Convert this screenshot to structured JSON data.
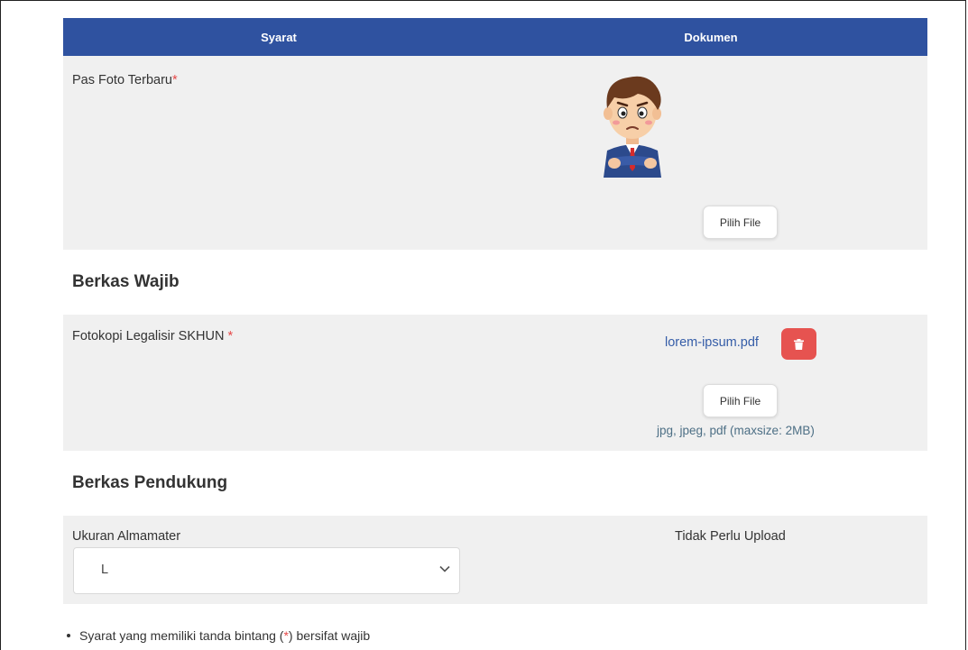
{
  "table": {
    "header_requirement": "Syarat",
    "header_document": "Dokumen"
  },
  "photo_row": {
    "label": "Pas Foto Terbaru",
    "asterisk": "*",
    "button_label": "Pilih File"
  },
  "section_wajib": {
    "title": "Berkas Wajib"
  },
  "skhun_row": {
    "label": "Fotokopi Legalisir SKHUN ",
    "asterisk": "*",
    "file_name": "lorem-ipsum.pdf",
    "button_label": "Pilih File",
    "hint": "jpg, jpeg, pdf (maxsize: 2MB)"
  },
  "section_pendukung": {
    "title": "Berkas Pendukung"
  },
  "almamater_row": {
    "label": "Ukuran Almamater",
    "selected_value": "L",
    "status": "Tidak Perlu Upload"
  },
  "note": {
    "prefix": "Syarat yang memiliki tanda bintang (",
    "asterisk": "*",
    "suffix": ") bersifat wajib"
  },
  "colors": {
    "header_bg": "#2f52a0",
    "row_bg": "#f0f0f0",
    "required": "#e54848",
    "link": "#355da8",
    "delete": "#e65350"
  },
  "icons": {
    "avatar": "avatar-illustration",
    "delete": "trash-icon",
    "select": "chevron-down-icon"
  }
}
